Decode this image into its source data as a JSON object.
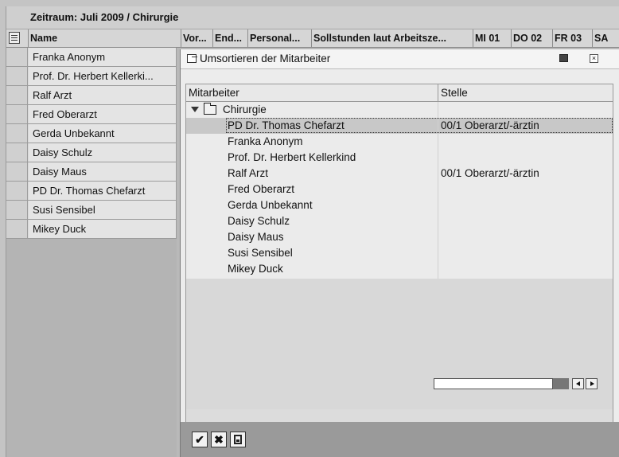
{
  "window": {
    "title": "Zeitraum: Juli 2009 / Chirurgie"
  },
  "grid_header": {
    "layout_icon": "layout-icon",
    "columns": [
      "Name",
      "Vor...",
      "End...",
      "Personal...",
      "Sollstunden laut Arbeitsze...",
      "MI 01",
      "DO 02",
      "FR 03",
      "SA"
    ]
  },
  "employees": [
    "Franka Anonym",
    "Prof. Dr. Herbert Kellerki...",
    "Ralf Arzt",
    "Fred Oberarzt",
    "Gerda Unbekannt",
    "Daisy Schulz",
    "Daisy Maus",
    "PD Dr. Thomas Chefarzt",
    "Susi Sensibel",
    "Mikey Duck"
  ],
  "dialog": {
    "title": "Umsortieren der Mitarbeiter",
    "title_icon": "dialog-icon",
    "columns": [
      "Mitarbeiter",
      "Stelle"
    ],
    "folder": "Chirurgie",
    "rows": [
      {
        "name": "PD Dr. Thomas Chefarzt",
        "stelle": "00/1 Oberarzt/-ärztin"
      },
      {
        "name": "Franka Anonym",
        "stelle": ""
      },
      {
        "name": "Prof. Dr. Herbert Kellerkind",
        "stelle": ""
      },
      {
        "name": "Ralf Arzt",
        "stelle": "00/1 Oberarzt/-ärztin"
      },
      {
        "name": "Fred Oberarzt",
        "stelle": ""
      },
      {
        "name": "Gerda Unbekannt",
        "stelle": ""
      },
      {
        "name": "Daisy Schulz",
        "stelle": ""
      },
      {
        "name": "Daisy Maus",
        "stelle": ""
      },
      {
        "name": "Susi Sensibel",
        "stelle": ""
      },
      {
        "name": "Mikey Duck",
        "stelle": ""
      }
    ],
    "footer_buttons": {
      "confirm": "✔",
      "cancel": "✖",
      "save_icon": "save-icon"
    }
  }
}
